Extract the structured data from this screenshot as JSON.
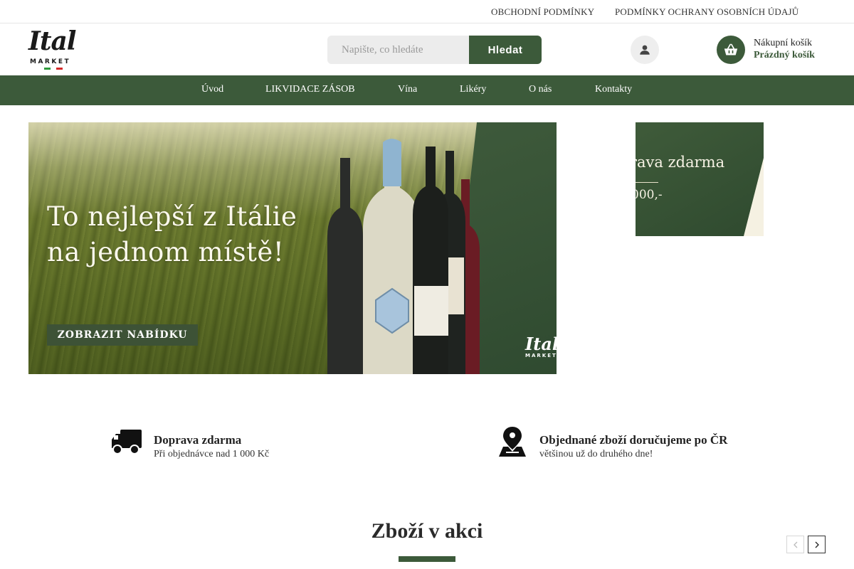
{
  "topbar": {
    "links": [
      "OBCHODNÍ PODMÍNKY",
      "PODMÍNKY OCHRANY OSOBNÍCH ÚDAJŮ"
    ]
  },
  "logo": {
    "script": "Ital",
    "word": "MARKET"
  },
  "search": {
    "placeholder": "Napište, co hledáte",
    "value": "",
    "button_label": "Hledat"
  },
  "cart": {
    "title": "Nákupní košík",
    "status": "Prázdný košík"
  },
  "nav": {
    "items": [
      "Úvod",
      "LIKVIDACE ZÁSOB",
      "Vína",
      "Likéry",
      "O nás",
      "Kontakty"
    ]
  },
  "hero": {
    "headline_line1": "To nejlepší z Itálie",
    "headline_line2": "na jednom místě!",
    "cta_label": "ZOBRAZIT NABÍDKU",
    "logo_script": "Ital",
    "logo_word": "MARKET"
  },
  "side_banner": {
    "line1": "rava zdarma",
    "line2": "000,-"
  },
  "features": [
    {
      "icon": "truck-icon",
      "title": "Doprava zdarma",
      "subtitle": "Při objednávce nad 1 000 Kč"
    },
    {
      "icon": "map-pin-icon",
      "title": "Objednané zboží doručujeme po ČR",
      "subtitle": "většinou už do druhého dne!"
    }
  ],
  "section": {
    "title": "Zboží v akci"
  },
  "colors": {
    "brand_green": "#3c5a3a",
    "top_border": "#e6e6e6"
  }
}
